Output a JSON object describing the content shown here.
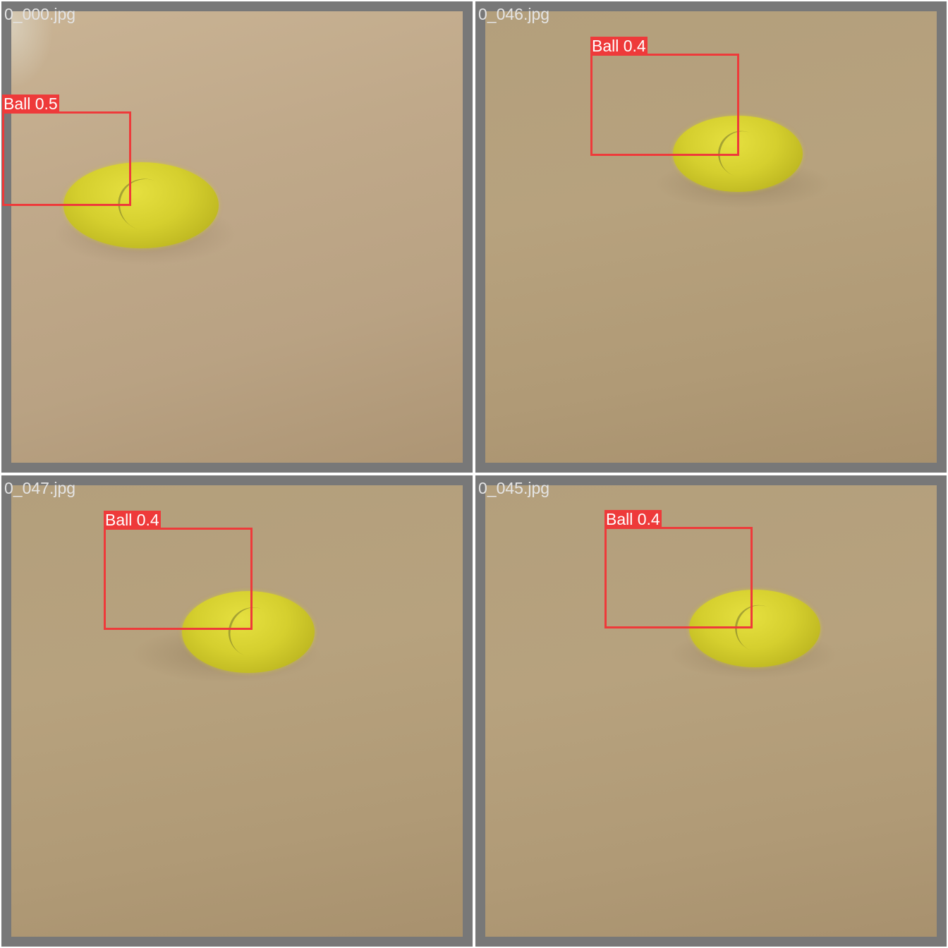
{
  "tiles": [
    {
      "filename": "0_000.jpg",
      "detection": {
        "label": "Ball 0.5",
        "class": "Ball",
        "confidence": 0.5
      }
    },
    {
      "filename": "0_046.jpg",
      "detection": {
        "label": "Ball 0.4",
        "class": "Ball",
        "confidence": 0.4
      }
    },
    {
      "filename": "0_047.jpg",
      "detection": {
        "label": "Ball 0.4",
        "class": "Ball",
        "confidence": 0.4
      }
    },
    {
      "filename": "0_045.jpg",
      "detection": {
        "label": "Ball 0.4",
        "class": "Ball",
        "confidence": 0.4
      }
    }
  ],
  "colors": {
    "tile_border": "#787878",
    "box": "#ee3a3a",
    "label_text": "#ffffff",
    "filename_text": "#e4e4e4",
    "ball": "#d5cf2e"
  }
}
